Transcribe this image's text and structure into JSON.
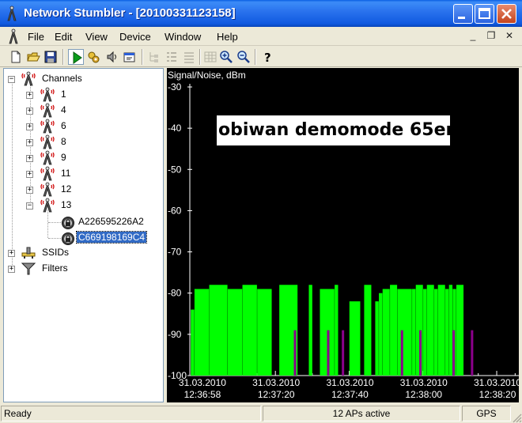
{
  "window": {
    "title": "Network Stumbler - [20100331123158]",
    "colors": {
      "titlebar": "#1059e0",
      "close_button": "#c4441d"
    }
  },
  "menu": {
    "items": [
      "File",
      "Edit",
      "View",
      "Device",
      "Window",
      "Help"
    ],
    "mdi_controls": [
      "_",
      "❐",
      "✕"
    ]
  },
  "toolbar": {
    "buttons": [
      {
        "name": "new-icon",
        "enabled": true
      },
      {
        "name": "open-folder-icon",
        "enabled": true
      },
      {
        "name": "save-disk-icon",
        "enabled": true
      },
      {
        "name": "play-scan-icon",
        "enabled": true
      },
      {
        "name": "auto-configure-icon",
        "enabled": true
      },
      {
        "name": "speaker-icon",
        "enabled": true
      },
      {
        "name": "properties-icon",
        "enabled": true
      },
      {
        "name": "tree-view-icon",
        "enabled": false
      },
      {
        "name": "list-view-icon",
        "enabled": false
      },
      {
        "name": "details-view-icon",
        "enabled": false
      },
      {
        "name": "grid-icon",
        "enabled": false
      },
      {
        "name": "zoom-in-icon",
        "enabled": true
      },
      {
        "name": "zoom-out-icon",
        "enabled": true
      },
      {
        "name": "help-icon",
        "enabled": true
      }
    ]
  },
  "tree": {
    "root": "Channels",
    "channels": [
      "1",
      "4",
      "6",
      "8",
      "9",
      "11",
      "12",
      "13"
    ],
    "aps": [
      "A226595226A2",
      "C669198169C4"
    ],
    "selected_ap": "C669198169C4",
    "ssids": "SSIDs",
    "filters": "Filters"
  },
  "graph": {
    "annotation": "obiwan demomode 65er",
    "colors": {
      "signal": "#00ff00",
      "noise": "#8b008b",
      "axis": "#ffffff",
      "background": "#000000"
    }
  },
  "chart_data": {
    "type": "bar",
    "ylabel": "Signal/Noise, dBm",
    "ylim": [
      -100,
      -30
    ],
    "yticks": [
      -30,
      -40,
      -50,
      -60,
      -70,
      -80,
      -90,
      -100
    ],
    "xticks": [
      {
        "date": "31.03.2010",
        "time": "12:36:58"
      },
      {
        "date": "31.03.2010",
        "time": "12:37:20"
      },
      {
        "date": "31.03.2010",
        "time": "12:37:40"
      },
      {
        "date": "31.03.2010",
        "time": "12:38:00"
      },
      {
        "date": "31.03.2010",
        "time": "12:38:20"
      }
    ],
    "xlim_seconds": [
      -3.2,
      86
    ],
    "series": [
      {
        "name": "Signal",
        "samples": [
          {
            "t": -3,
            "w": 1,
            "v": -84
          },
          {
            "t": -2,
            "w": 4,
            "v": -79
          },
          {
            "t": 2,
            "w": 5,
            "v": -78
          },
          {
            "t": 7,
            "w": 4,
            "v": -79
          },
          {
            "t": 11,
            "w": 4,
            "v": -78
          },
          {
            "t": 15,
            "w": 4,
            "v": -79
          },
          {
            "t": 21,
            "w": 5,
            "v": -78
          },
          {
            "t": 29,
            "w": 1,
            "v": -78
          },
          {
            "t": 32,
            "w": 4,
            "v": -79
          },
          {
            "t": 36,
            "w": 1,
            "v": -78
          },
          {
            "t": 40,
            "w": 3,
            "v": -82
          },
          {
            "t": 44,
            "w": 2,
            "v": -78
          },
          {
            "t": 47,
            "w": 1,
            "v": -82
          },
          {
            "t": 48,
            "w": 1,
            "v": -80
          },
          {
            "t": 49,
            "w": 2,
            "v": -79
          },
          {
            "t": 51,
            "w": 2,
            "v": -78
          },
          {
            "t": 53,
            "w": 4,
            "v": -79
          },
          {
            "t": 57,
            "w": 1,
            "v": -79
          },
          {
            "t": 58,
            "w": 2,
            "v": -78
          },
          {
            "t": 60,
            "w": 1,
            "v": -79
          },
          {
            "t": 61,
            "w": 2,
            "v": -78
          },
          {
            "t": 63,
            "w": 1,
            "v": -79
          },
          {
            "t": 64,
            "w": 2,
            "v": -78
          },
          {
            "t": 66,
            "w": 1,
            "v": -79
          },
          {
            "t": 67,
            "w": 1,
            "v": -78
          },
          {
            "t": 68,
            "w": 1,
            "v": -79
          },
          {
            "t": 69,
            "w": 2,
            "v": -78
          }
        ]
      },
      {
        "name": "Noise",
        "samples": [
          {
            "t": 25,
            "v": -89
          },
          {
            "t": 34,
            "v": -89
          },
          {
            "t": 38,
            "v": -89
          },
          {
            "t": 54,
            "v": -89
          },
          {
            "t": 59,
            "v": -89
          },
          {
            "t": 68,
            "v": -89
          },
          {
            "t": 73,
            "v": -89
          }
        ]
      }
    ]
  },
  "status": {
    "ready": "Ready",
    "aps_active": "12 APs active",
    "gps": "GPS"
  }
}
